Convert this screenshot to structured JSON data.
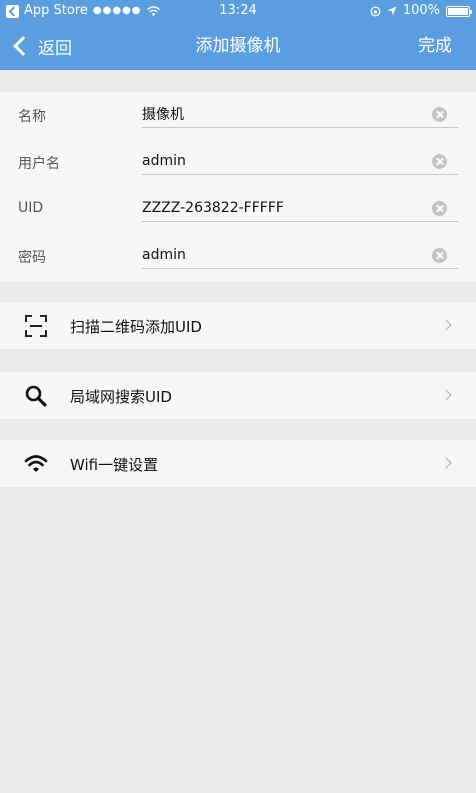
{
  "status_bar": {
    "carrier": "App Store",
    "signal": "●●●●●",
    "time": "13:24",
    "battery": "100%",
    "battery_level": 1.0
  },
  "nav": {
    "back_label": "返回",
    "title": "添加摄像机",
    "done_label": "完成"
  },
  "form": {
    "fields": [
      {
        "label": "名称",
        "value": "摄像机"
      },
      {
        "label": "用户名",
        "value": "admin"
      },
      {
        "label": "UID",
        "value": "ZZZZ-263822-FFFFF"
      },
      {
        "label": "密码",
        "value": "admin"
      }
    ]
  },
  "menu": [
    {
      "label": "扫描二维码添加UID",
      "icon": "qr-scan-icon"
    },
    {
      "label": "局域网搜索UID",
      "icon": "search-icon"
    },
    {
      "label": "Wifi一键设置",
      "icon": "wifi-icon"
    }
  ],
  "colors": {
    "header": "#5b9ee0",
    "background": "#ebebeb",
    "row": "#f7f7f7"
  }
}
